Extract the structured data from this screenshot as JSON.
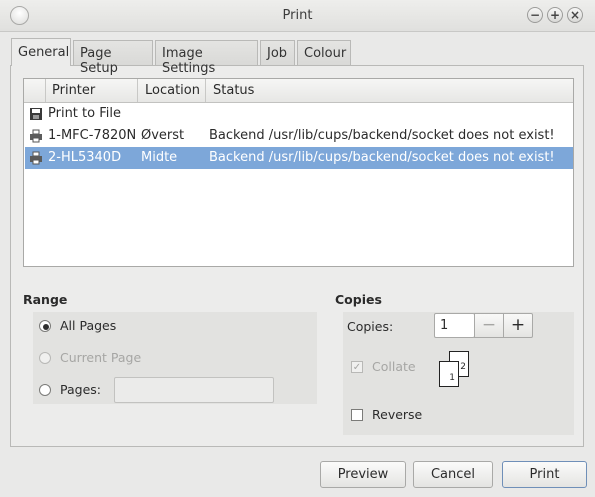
{
  "window": {
    "title": "Print"
  },
  "tabs": [
    "General",
    "Page Setup",
    "Image Settings",
    "Job",
    "Colour"
  ],
  "printer_list": {
    "columns": [
      "Printer",
      "Location",
      "Status"
    ],
    "rows": [
      {
        "icon": "file-save-icon",
        "printer": "Print to File",
        "location": "",
        "status": ""
      },
      {
        "icon": "printer-icon",
        "printer": "1-MFC-7820N",
        "location": "Øverst",
        "status": "Backend /usr/lib/cups/backend/socket does not exist!"
      },
      {
        "icon": "printer-icon",
        "printer": "2-HL5340D",
        "location": "Midte",
        "status": "Backend /usr/lib/cups/backend/socket does not exist!",
        "selected": true
      }
    ]
  },
  "range": {
    "title": "Range",
    "all_pages": "All Pages",
    "current_page": "Current Page",
    "pages": "Pages:",
    "pages_value": "",
    "selected": "all_pages"
  },
  "copies": {
    "title": "Copies",
    "copies_label": "Copies:",
    "copies_value": "1",
    "minus": "−",
    "plus": "+",
    "collate": "Collate",
    "collate_checked": true,
    "reverse": "Reverse",
    "reverse_checked": false,
    "collate_page_back": "2",
    "collate_page_front": "1"
  },
  "buttons": {
    "preview": "Preview",
    "cancel": "Cancel",
    "print": "Print"
  }
}
